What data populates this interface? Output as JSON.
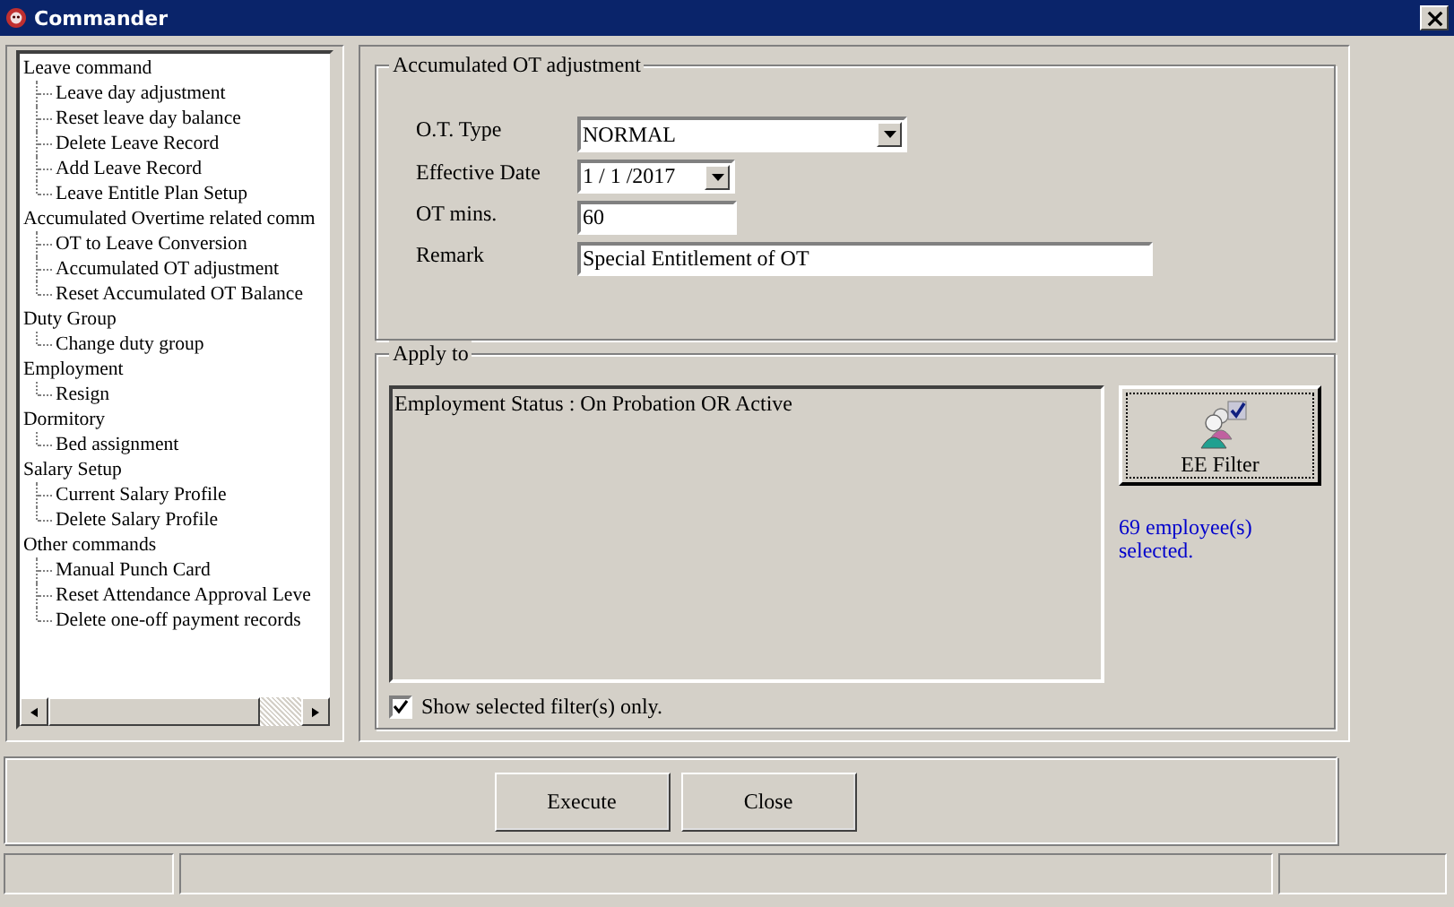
{
  "window": {
    "title": "Commander"
  },
  "tree": [
    {
      "label": "Leave command",
      "children": [
        {
          "label": "Leave day adjustment"
        },
        {
          "label": "Reset leave day balance"
        },
        {
          "label": "Delete Leave Record"
        },
        {
          "label": "Add Leave Record"
        },
        {
          "label": "Leave Entitle Plan Setup"
        }
      ]
    },
    {
      "label": "Accumulated Overtime related comm",
      "children": [
        {
          "label": "OT to Leave Conversion"
        },
        {
          "label": "Accumulated OT adjustment"
        },
        {
          "label": "Reset Accumulated OT Balance"
        }
      ]
    },
    {
      "label": "Duty Group",
      "children": [
        {
          "label": "Change duty group"
        }
      ]
    },
    {
      "label": "Employment",
      "children": [
        {
          "label": "Resign"
        }
      ]
    },
    {
      "label": "Dormitory",
      "children": [
        {
          "label": "Bed assignment"
        }
      ]
    },
    {
      "label": "Salary Setup",
      "children": [
        {
          "label": "Current Salary Profile"
        },
        {
          "label": "Delete Salary Profile"
        }
      ]
    },
    {
      "label": "Other commands",
      "children": [
        {
          "label": "Manual Punch Card"
        },
        {
          "label": "Reset Attendance Approval Leve"
        },
        {
          "label": "Delete one-off payment records"
        }
      ]
    }
  ],
  "adjustment": {
    "title": "Accumulated OT adjustment",
    "fields": [
      {
        "label": "O.T. Type",
        "kind": "select",
        "value": "NORMAL"
      },
      {
        "label": "Effective Date",
        "kind": "date",
        "value": "1 / 1 /2017"
      },
      {
        "label": "OT mins.",
        "kind": "text",
        "value": "60"
      },
      {
        "label": "Remark",
        "kind": "wide",
        "value": "Special Entitlement of OT"
      }
    ]
  },
  "apply_to": {
    "title": "Apply to",
    "filter_text": "Employment Status : On Probation OR Active",
    "filter_button": "EE Filter",
    "selected_count": "69 employee(s) selected.",
    "show_selected": {
      "label": "Show selected filter(s) only.",
      "checked": true
    }
  },
  "buttons": [
    "Execute",
    "Close"
  ]
}
